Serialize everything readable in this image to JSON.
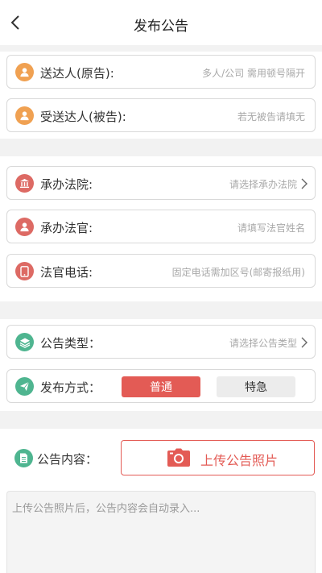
{
  "header": {
    "title": "发布公告"
  },
  "fields": {
    "sender": {
      "label": "送达人(原告):",
      "placeholder": "多人/公司 需用顿号隔开"
    },
    "recipient": {
      "label": "受送达人(被告):",
      "placeholder": "若无被告请填无"
    },
    "court": {
      "label": "承办法院:",
      "placeholder": "请选择承办法院"
    },
    "judge": {
      "label": "承办法官:",
      "placeholder": "请填写法官姓名"
    },
    "phone": {
      "label": "法官电话:",
      "placeholder": "固定电话需加区号(邮寄报纸用)"
    },
    "notice_type": {
      "label": "公告类型：",
      "placeholder": "请选择公告类型"
    },
    "publish_method": {
      "label": "发布方式：",
      "options": [
        "普通",
        "特急"
      ],
      "selected": "普通"
    }
  },
  "content": {
    "label": "公告内容：",
    "upload_label": "上传公告照片",
    "placeholder": "上传公告照片后，公告内容会自动录入..."
  },
  "colors": {
    "accent": "#e35b55",
    "orange_icon": "#f0a152",
    "red_icon": "#dd6a64",
    "green_icon": "#4fb590"
  }
}
